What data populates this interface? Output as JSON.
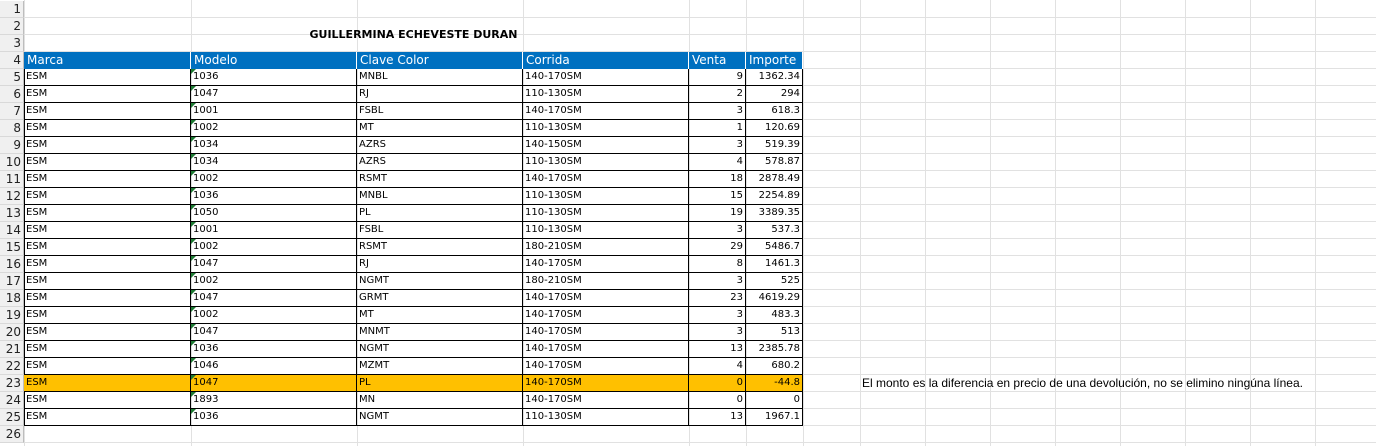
{
  "row_numbers": [
    "1",
    "2",
    "3",
    "4",
    "5",
    "6",
    "7",
    "8",
    "9",
    "10",
    "11",
    "12",
    "13",
    "14",
    "15",
    "16",
    "17",
    "18",
    "19",
    "20",
    "21",
    "22",
    "23",
    "24",
    "25",
    "26"
  ],
  "title": "GUILLERMINA ECHEVESTE DURAN",
  "columns": [
    "Marca",
    "Modelo",
    "Clave Color",
    "Corrida",
    "Venta",
    "Importe"
  ],
  "rows": [
    [
      "ESM",
      "1036",
      "MNBL",
      "140-170SM",
      "9",
      "1362.34"
    ],
    [
      "ESM",
      "1047",
      "RJ",
      "110-130SM",
      "2",
      "294"
    ],
    [
      "ESM",
      "1001",
      "FSBL",
      "140-170SM",
      "3",
      "618.3"
    ],
    [
      "ESM",
      "1002",
      "MT",
      "110-130SM",
      "1",
      "120.69"
    ],
    [
      "ESM",
      "1034",
      "AZRS",
      "140-150SM",
      "3",
      "519.39"
    ],
    [
      "ESM",
      "1034",
      "AZRS",
      "110-130SM",
      "4",
      "578.87"
    ],
    [
      "ESM",
      "1002",
      "RSMT",
      "140-170SM",
      "18",
      "2878.49"
    ],
    [
      "ESM",
      "1036",
      "MNBL",
      "110-130SM",
      "15",
      "2254.89"
    ],
    [
      "ESM",
      "1050",
      "PL",
      "110-130SM",
      "19",
      "3389.35"
    ],
    [
      "ESM",
      "1001",
      "FSBL",
      "110-130SM",
      "3",
      "537.3"
    ],
    [
      "ESM",
      "1002",
      "RSMT",
      "180-210SM",
      "29",
      "5486.7"
    ],
    [
      "ESM",
      "1047",
      "RJ",
      "140-170SM",
      "8",
      "1461.3"
    ],
    [
      "ESM",
      "1002",
      "NGMT",
      "180-210SM",
      "3",
      "525"
    ],
    [
      "ESM",
      "1047",
      "GRMT",
      "140-170SM",
      "23",
      "4619.29"
    ],
    [
      "ESM",
      "1002",
      "MT",
      "140-170SM",
      "3",
      "483.3"
    ],
    [
      "ESM",
      "1047",
      "MNMT",
      "140-170SM",
      "3",
      "513"
    ],
    [
      "ESM",
      "1036",
      "NGMT",
      "140-170SM",
      "13",
      "2385.78"
    ],
    [
      "ESM",
      "1046",
      "MZMT",
      "140-170SM",
      "4",
      "680.2"
    ],
    [
      "ESM",
      "1047",
      "PL",
      "140-170SM",
      "0",
      "-44.8"
    ],
    [
      "ESM",
      "1893",
      "MN",
      "140-170SM",
      "0",
      "0"
    ],
    [
      "ESM",
      "1036",
      "NGMT",
      "110-130SM",
      "13",
      "1967.1"
    ]
  ],
  "highlight_row_index": 18,
  "note": "El monto es la diferencia en precio de una devolución, no se elimino ningúna línea.",
  "colors": {
    "header_bg": "#0070c0",
    "highlight_bg": "#ffc000",
    "error_triangle": "#1e7b34"
  }
}
